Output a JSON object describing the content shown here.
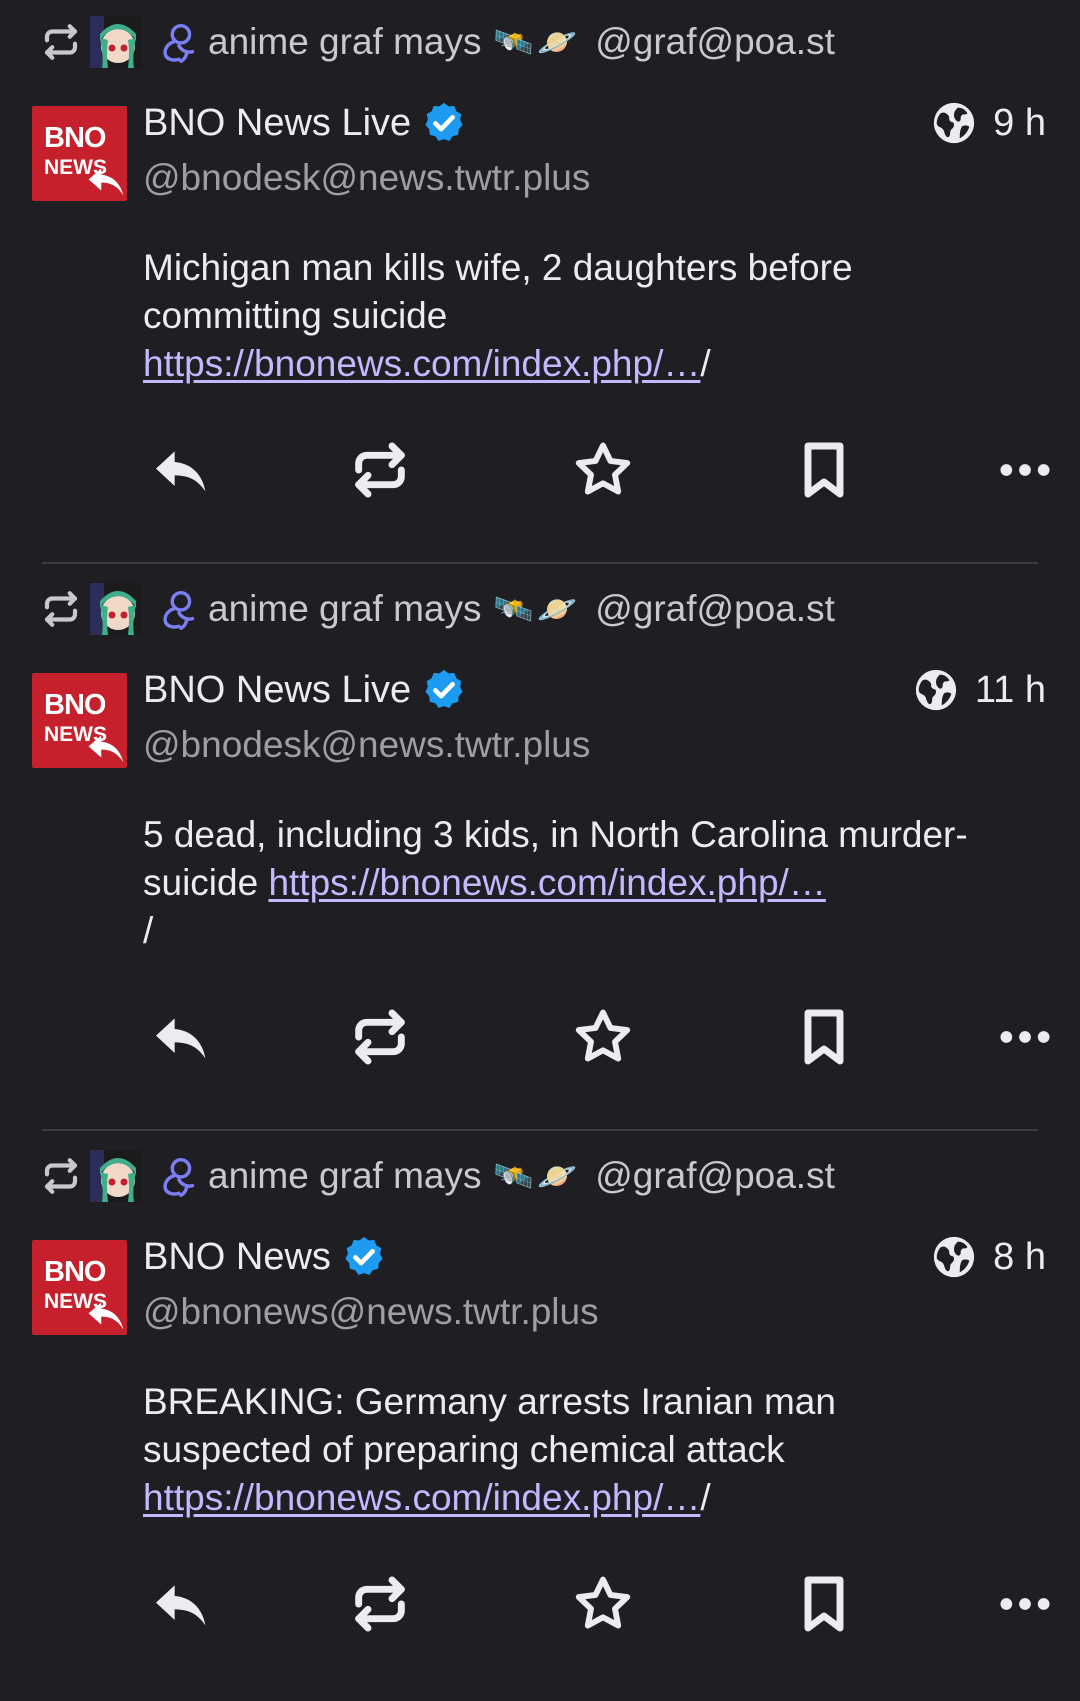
{
  "colors": {
    "background": "#1f1e22",
    "text": "#ececf0",
    "muted": "#9e9ea4",
    "link": "#c5b8ff",
    "verified": "#1d9bf0",
    "avatar_red": "#c5202c"
  },
  "posts": [
    {
      "boost": {
        "icon": "boost-icon",
        "booster_name": "anime graf mays",
        "emoji_satellite": "🛰️",
        "emoji_planet": "🪐",
        "booster_handle": "@graf@poa.st"
      },
      "author": {
        "avatar_line1": "BNO",
        "avatar_line2": "NEWS",
        "display_name": "BNO News Live",
        "verified_icon": "verified-icon",
        "handle": "@bnodesk@news.twtr.plus"
      },
      "visibility_icon": "globe-icon",
      "time": "9 h",
      "text": "Michigan man kills wife, 2 daughters before committing suicide ",
      "link": "https://bnonews.com/index.php/…",
      "trailing": "/"
    },
    {
      "boost": {
        "icon": "boost-icon",
        "booster_name": "anime graf mays",
        "emoji_satellite": "🛰️",
        "emoji_planet": "🪐",
        "booster_handle": "@graf@poa.st"
      },
      "author": {
        "avatar_line1": "BNO",
        "avatar_line2": "NEWS",
        "display_name": "BNO News Live",
        "verified_icon": "verified-icon",
        "handle": "@bnodesk@news.twtr.plus"
      },
      "visibility_icon": "globe-icon",
      "time": "11 h",
      "text": "5 dead, including 3 kids, in North Carolina murder-suicide ",
      "link": "https://bnonews.com/index.php/…",
      "trailing": "/"
    },
    {
      "boost": {
        "icon": "boost-icon",
        "booster_name": "anime graf mays",
        "emoji_satellite": "🛰️",
        "emoji_planet": "🪐",
        "booster_handle": "@graf@poa.st"
      },
      "author": {
        "avatar_line1": "BNO",
        "avatar_line2": "NEWS",
        "display_name": "BNO News",
        "verified_icon": "verified-icon",
        "handle": "@bnonews@news.twtr.plus"
      },
      "visibility_icon": "globe-icon",
      "time": "8 h",
      "text": "BREAKING: Germany arrests Iranian man suspected of preparing chemical attack ",
      "link": "https://bnonews.com/index.php/…",
      "trailing": "/"
    }
  ],
  "action_icons": [
    "reply-icon",
    "boost-icon",
    "favourite-icon",
    "bookmark-icon",
    "more-icon"
  ]
}
